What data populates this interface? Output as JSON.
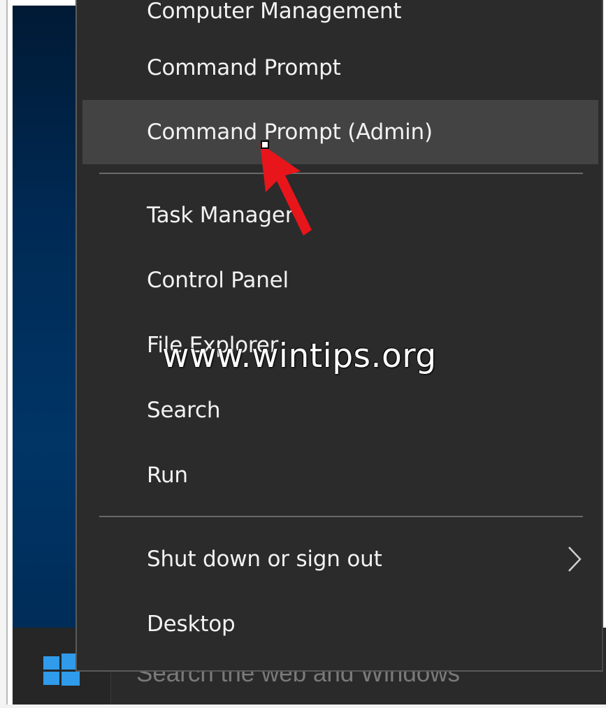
{
  "menu": {
    "items": [
      {
        "label": "Computer Management"
      },
      {
        "label": "Command Prompt"
      },
      {
        "label": "Command Prompt (Admin)"
      },
      {
        "label": "Task Manager"
      },
      {
        "label": "Control Panel"
      },
      {
        "label": "File Explorer"
      },
      {
        "label": "Search"
      },
      {
        "label": "Run"
      },
      {
        "label": "Shut down or sign out"
      },
      {
        "label": "Desktop"
      }
    ],
    "highlighted_item": "Command Prompt (Admin)",
    "submenu_icon": "chevron-right-icon"
  },
  "taskbar": {
    "search_placeholder": "Search the web and Windows",
    "start_icon": "windows-logo-icon"
  },
  "watermark": "www.wintips.org",
  "annotation": {
    "icon": "red-arrow-icon",
    "color": "#e8151b"
  },
  "colors": {
    "menu_background": "#2b2b2b",
    "highlight_background": "#434343",
    "windows_accent": "#2f9bea",
    "desktop": "#002a55"
  }
}
